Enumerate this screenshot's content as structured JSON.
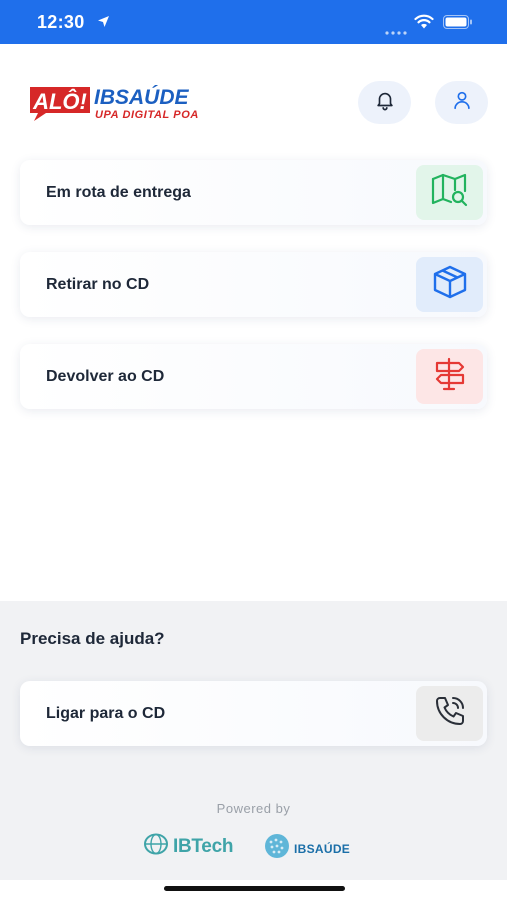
{
  "status_bar": {
    "time": "12:30"
  },
  "logo": {
    "alo": "ALÔ!",
    "ibsaude": "IBSAÚDE",
    "subtitle": "UPA DIGITAL POA"
  },
  "header": {
    "notifications_icon": "bell-icon",
    "profile_icon": "user-icon"
  },
  "actions": [
    {
      "label": "Em rota de entrega",
      "icon": "map-search-icon",
      "color": "#22b35e"
    },
    {
      "label": "Retirar no CD",
      "icon": "box-icon",
      "color": "#1f6feb"
    },
    {
      "label": "Devolver ao CD",
      "icon": "signpost-icon",
      "color": "#e53935"
    }
  ],
  "help": {
    "title": "Precisa de ajuda?",
    "call": {
      "label": "Ligar para o CD",
      "icon": "phone-call-icon"
    }
  },
  "footer": {
    "powered_by": "Powered by",
    "brands": [
      "IBTech",
      "IBSAÚDE"
    ]
  },
  "colors": {
    "primary": "#1f6feb",
    "logo_red": "#d62828",
    "logo_blue": "#1b5fc1"
  }
}
